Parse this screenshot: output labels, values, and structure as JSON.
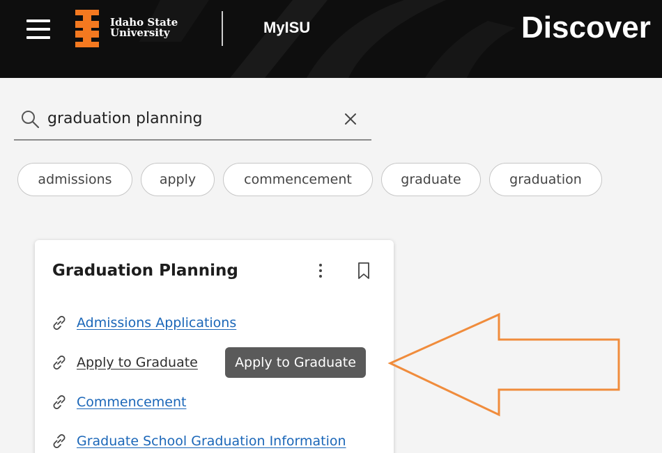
{
  "header": {
    "logo_line1": "Idaho State",
    "logo_line2": "University",
    "portal_name": "MyISU",
    "page_title": "Discover",
    "brand_orange": "#f47920"
  },
  "search": {
    "value": "graduation planning",
    "icon": "search-icon",
    "clear_icon": "close-icon"
  },
  "chips": [
    "admissions",
    "apply",
    "commencement",
    "graduate",
    "graduation"
  ],
  "card": {
    "title": "Graduation Planning",
    "menu_icon": "kebab-icon",
    "bookmark_icon": "bookmark-icon",
    "links": [
      {
        "label": "Admissions Applications",
        "icon": "link-icon"
      },
      {
        "label": "Apply to Graduate",
        "icon": "link-icon"
      },
      {
        "label": "Commencement",
        "icon": "link-icon"
      },
      {
        "label": "Graduate School Graduation Information",
        "icon": "link-icon"
      }
    ]
  },
  "tooltip": {
    "text": "Apply to Graduate"
  },
  "annotation": {
    "icon": "arrow-left-icon",
    "color": "#f08c3c"
  }
}
